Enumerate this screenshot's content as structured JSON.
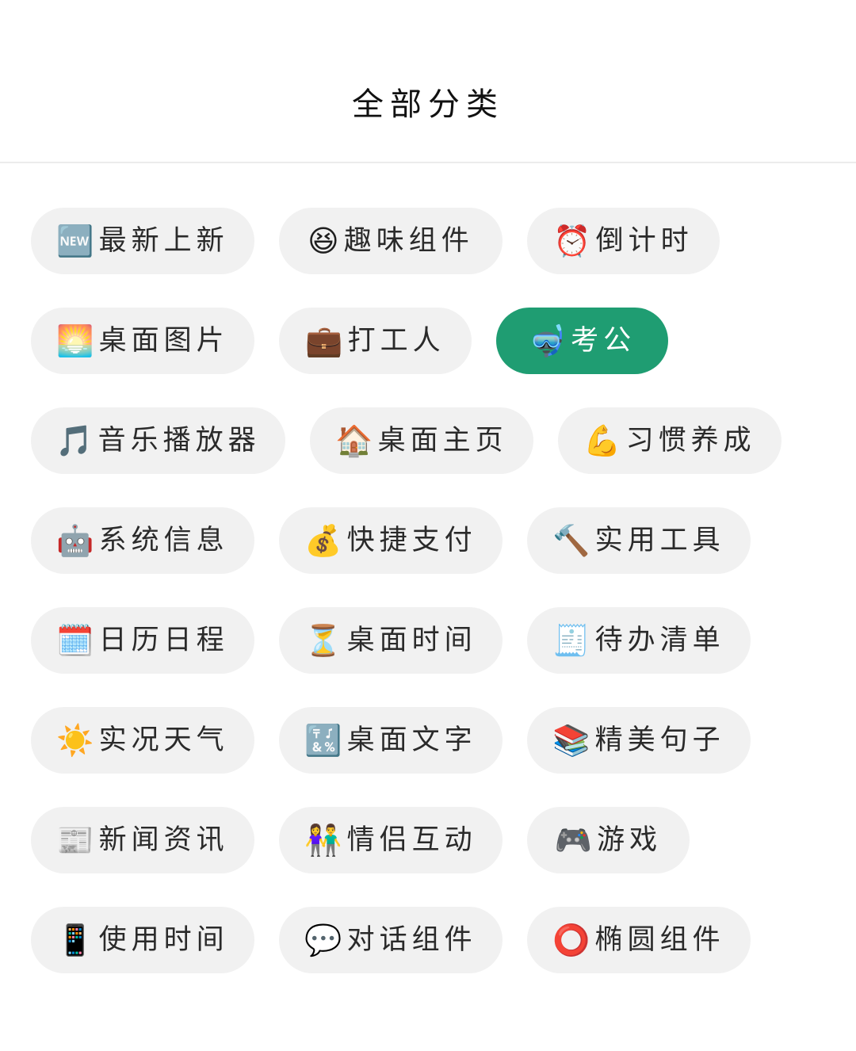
{
  "header": {
    "title": "全部分类"
  },
  "colors": {
    "active_chip": "#1f9d72",
    "chip": "#f1f1f1"
  },
  "categories": [
    {
      "emoji": "🆕",
      "icon": "new-icon",
      "label": "最新上新"
    },
    {
      "emoji": "😆",
      "icon": "laughing-face-icon",
      "label": "趣味组件"
    },
    {
      "emoji": "⏰",
      "icon": "alarm-clock-icon",
      "label": "倒计时"
    },
    {
      "emoji": "🌅",
      "icon": "sunrise-icon",
      "label": "桌面图片"
    },
    {
      "emoji": "💼",
      "icon": "briefcase-icon",
      "label": "打工人"
    },
    {
      "emoji": "🤿",
      "icon": "diving-mask-icon",
      "label": "考公",
      "selected": true
    },
    {
      "emoji": "🎵",
      "icon": "music-note-icon",
      "label": "音乐播放器"
    },
    {
      "emoji": "🏠",
      "icon": "house-icon",
      "label": "桌面主页"
    },
    {
      "emoji": "💪",
      "icon": "flexed-biceps-icon",
      "label": "习惯养成"
    },
    {
      "emoji": "🤖",
      "icon": "robot-icon",
      "label": "系统信息"
    },
    {
      "emoji": "💰",
      "icon": "money-bag-icon",
      "label": "快捷支付"
    },
    {
      "emoji": "🔨",
      "icon": "hammer-icon",
      "label": "实用工具"
    },
    {
      "emoji": "🗓️",
      "icon": "calendar-icon",
      "label": "日历日程"
    },
    {
      "emoji": "⏳",
      "icon": "hourglass-icon",
      "label": "桌面时间"
    },
    {
      "emoji": "🧾",
      "icon": "receipt-icon",
      "label": "待办清单"
    },
    {
      "emoji": "☀️",
      "icon": "sun-icon",
      "label": "实况天气"
    },
    {
      "emoji": "🔣",
      "icon": "symbols-icon",
      "label": "桌面文字"
    },
    {
      "emoji": "📚",
      "icon": "books-icon",
      "label": "精美句子"
    },
    {
      "emoji": "📰",
      "icon": "newspaper-icon",
      "label": "新闻资讯"
    },
    {
      "emoji": "👫",
      "icon": "couple-icon",
      "label": "情侣互动"
    },
    {
      "emoji": "🎮",
      "icon": "game-controller-icon",
      "label": "游戏"
    },
    {
      "emoji": "📱",
      "icon": "mobile-phone-icon",
      "label": "使用时间"
    },
    {
      "emoji": "💬",
      "icon": "speech-bubble-icon",
      "label": "对话组件"
    },
    {
      "emoji": "⭕",
      "icon": "hollow-circle-icon",
      "label": "椭圆组件"
    }
  ]
}
